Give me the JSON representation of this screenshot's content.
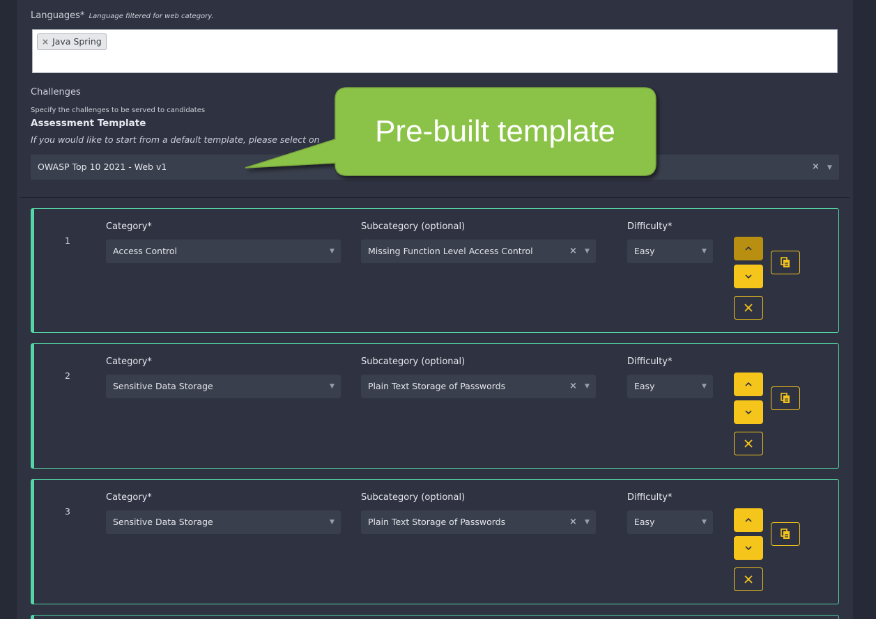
{
  "languages": {
    "label": "Languages*",
    "note": "Language filtered for web category.",
    "chip": "Java Spring",
    "chip_remove": "×"
  },
  "challenges": {
    "title": "Challenges",
    "subtitle": "Specify the challenges to be served to candidates"
  },
  "assessment_template": {
    "title": "Assessment Template",
    "note": "If you would like to start from a default template, please select on",
    "selected": "OWASP Top 10 2021 - Web v1"
  },
  "callout": {
    "text": "Pre-built template",
    "fill": "#8bc34a",
    "stroke": "#7aa83e"
  },
  "field_labels": {
    "category": "Category*",
    "subcategory": "Subcategory (optional)",
    "difficulty": "Difficulty*"
  },
  "rows": [
    {
      "number": "1",
      "category": "Access Control",
      "subcategory": "Missing Function Level Access Control",
      "difficulty": "Easy"
    },
    {
      "number": "2",
      "category": "Sensitive Data Storage",
      "subcategory": "Plain Text Storage of Passwords",
      "difficulty": "Easy"
    },
    {
      "number": "3",
      "category": "Sensitive Data Storage",
      "subcategory": "Plain Text Storage of Passwords",
      "difficulty": "Easy"
    }
  ],
  "icons": {
    "clear": "×",
    "caret": "▼",
    "move_up": "chevron-up-icon",
    "move_down": "chevron-down-icon",
    "remove": "close-icon",
    "duplicate": "copy-icon"
  },
  "colors": {
    "accent_green": "#54d6a6",
    "button_yellow": "#f6c51c",
    "panel": "#2e3241"
  }
}
